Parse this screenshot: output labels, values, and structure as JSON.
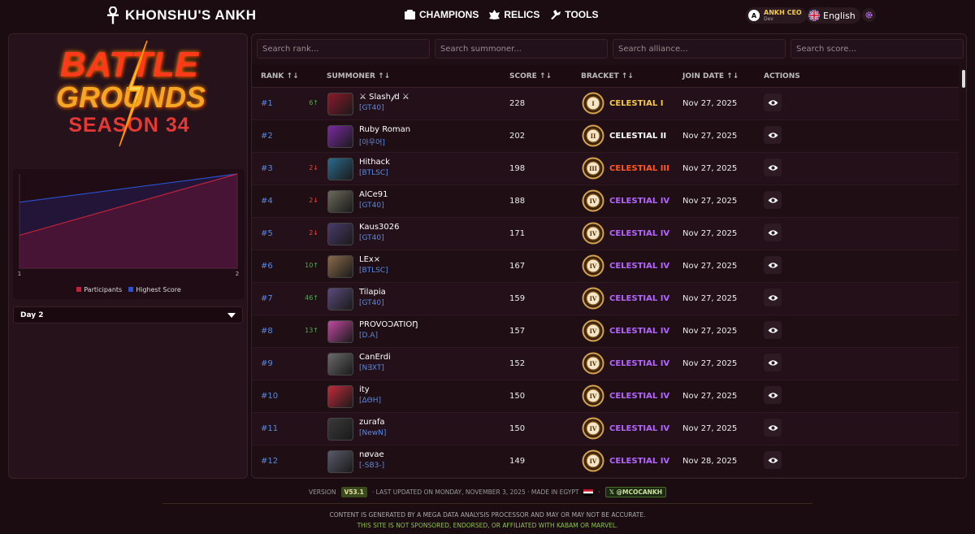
{
  "header": {
    "title": "KHONSHU'S ANKH",
    "nav": [
      {
        "label": "CHAMPIONS",
        "icon": "champions-icon"
      },
      {
        "label": "RELICS",
        "icon": "relics-icon"
      },
      {
        "label": "TOOLS",
        "icon": "tools-icon"
      }
    ],
    "user": {
      "initial": "A",
      "name": "ANKH CEO",
      "role": "Dev"
    },
    "language": "English"
  },
  "left": {
    "logo": {
      "line1": "BATTLE",
      "line2": "GROUNDS",
      "season": "SEASON 34"
    },
    "day_select": "Day 2"
  },
  "chart_data": {
    "type": "area",
    "x": [
      1,
      2
    ],
    "series": [
      {
        "name": "Participants",
        "values": [
          0.35,
          1.0
        ],
        "color": "#c0223a"
      },
      {
        "name": "Highest Score",
        "values": [
          0.7,
          1.0
        ],
        "color": "#2a52d0"
      }
    ],
    "xticks": [
      "1",
      "2"
    ],
    "legend": "bottom"
  },
  "search": {
    "rank": "Search rank...",
    "summoner": "Search summoner...",
    "alliance": "Search alliance...",
    "score": "Search score..."
  },
  "table": {
    "headers": {
      "rank": "RANK ↑↓",
      "summoner": "SUMMONER ↑↓",
      "score": "SCORE ↑↓",
      "bracket": "BRACKET ↑↓",
      "join": "JOIN DATE ↑↓",
      "actions": "ACTIONS"
    },
    "rows": [
      {
        "rank": "#1",
        "change": "6↑",
        "dir": "up",
        "name": "⚔ Slash𝒻d ⚔",
        "tag": "[GT40]",
        "score": "228",
        "bracket": "CELESTIAL I",
        "tier": "I",
        "bcolor": "#f2c94c",
        "date": "Nov 27, 2025",
        "av": "#8a1a2a"
      },
      {
        "rank": "#2",
        "change": "",
        "dir": "",
        "name": "Ruby Roman",
        "tag": "[아우어]",
        "score": "202",
        "bracket": "CELESTIAL II",
        "tier": "II",
        "bcolor": "#ffffff",
        "date": "Nov 27, 2025",
        "av": "#7a2aa0"
      },
      {
        "rank": "#3",
        "change": "2↓",
        "dir": "down",
        "name": "Hithack",
        "tag": "[BTLSC]",
        "score": "198",
        "bracket": "CELESTIAL III",
        "tier": "III",
        "bcolor": "#ff5722",
        "date": "Nov 27, 2025",
        "av": "#2a6a8a"
      },
      {
        "rank": "#4",
        "change": "2↓",
        "dir": "down",
        "name": "AlCe91",
        "tag": "[GT40]",
        "score": "188",
        "bracket": "CELESTIAL IV",
        "tier": "IV",
        "bcolor": "#b266ff",
        "date": "Nov 27, 2025",
        "av": "#6a6a5a"
      },
      {
        "rank": "#5",
        "change": "2↓",
        "dir": "down",
        "name": "Kaus3026",
        "tag": "[GT40]",
        "score": "171",
        "bracket": "CELESTIAL IV",
        "tier": "IV",
        "bcolor": "#b266ff",
        "date": "Nov 27, 2025",
        "av": "#4a3a6a"
      },
      {
        "rank": "#6",
        "change": "10↑",
        "dir": "up",
        "name": "LEx×",
        "tag": "[BTLSC]",
        "score": "167",
        "bracket": "CELESTIAL IV",
        "tier": "IV",
        "bcolor": "#b266ff",
        "date": "Nov 27, 2025",
        "av": "#8a6a4a"
      },
      {
        "rank": "#7",
        "change": "46↑",
        "dir": "up",
        "name": "Tilapia",
        "tag": "[GT40]",
        "score": "159",
        "bracket": "CELESTIAL IV",
        "tier": "IV",
        "bcolor": "#b266ff",
        "date": "Nov 27, 2025",
        "av": "#5a4a7a"
      },
      {
        "rank": "#8",
        "change": "13↑",
        "dir": "up",
        "name": "PROVOƆATIOŊ",
        "tag": "[D.A]",
        "score": "157",
        "bracket": "CELESTIAL IV",
        "tier": "IV",
        "bcolor": "#b266ff",
        "date": "Nov 27, 2025",
        "av": "#c04aa0"
      },
      {
        "rank": "#9",
        "change": "",
        "dir": "",
        "name": "CanErdi",
        "tag": "[N∃XT]",
        "score": "152",
        "bracket": "CELESTIAL IV",
        "tier": "IV",
        "bcolor": "#b266ff",
        "date": "Nov 27, 2025",
        "av": "#6a6a6a"
      },
      {
        "rank": "#10",
        "change": "",
        "dir": "",
        "name": "ity",
        "tag": "[ΔΘH]",
        "score": "150",
        "bracket": "CELESTIAL IV",
        "tier": "IV",
        "bcolor": "#b266ff",
        "date": "Nov 27, 2025",
        "av": "#c02a3a"
      },
      {
        "rank": "#11",
        "change": "",
        "dir": "",
        "name": "zurafa",
        "tag": "[NewN]",
        "score": "150",
        "bracket": "CELESTIAL IV",
        "tier": "IV",
        "bcolor": "#b266ff",
        "date": "Nov 27, 2025",
        "av": "#3a3a3a"
      },
      {
        "rank": "#12",
        "change": "",
        "dir": "",
        "name": "nøvae",
        "tag": "[-SB3-]",
        "score": "149",
        "bracket": "CELESTIAL IV",
        "tier": "IV",
        "bcolor": "#b266ff",
        "date": "Nov 28, 2025",
        "av": "#5a5a6a"
      }
    ]
  },
  "footer": {
    "version_label": "VERSION",
    "version": "V53.1",
    "updated": "· LAST UPDATED ON MONDAY, NOVEMBER 3, 2025 · MADE IN EGYPT",
    "social": "@MCOCANKH",
    "disclaimer": "CONTENT IS GENERATED BY A MEGA DATA ANALYSIS PROCESSOR AND MAY OR MAY NOT BE ACCURATE.",
    "notice": "THIS SITE IS NOT SPONSORED, ENDORSED, OR AFFILIATED WITH KABAM OR MARVEL."
  }
}
